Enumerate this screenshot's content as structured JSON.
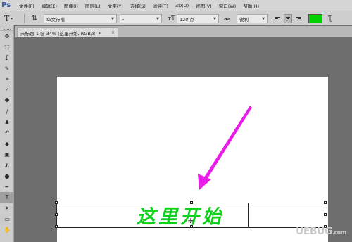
{
  "app": {
    "logo": "Ps"
  },
  "menu": [
    "文件(F)",
    "编辑(E)",
    "图像(I)",
    "图层(L)",
    "文字(Y)",
    "选择(S)",
    "滤镜(T)",
    "3D(D)",
    "视图(V)",
    "窗口(W)",
    "帮助(H)"
  ],
  "options_bar": {
    "tool_icon": "T",
    "font_family": "华文行楷",
    "font_style": "-",
    "font_size": "120 点",
    "anti_alias": "锐利",
    "aa_label": "aa",
    "text_color": "#00d000",
    "align_active": "center"
  },
  "document": {
    "tab_title": "未标题-1 @ 34% (这里开始, RGB/8) *",
    "close_glyph": "×"
  },
  "canvas": {
    "typed_text": "这里开始",
    "arrow_color": "#e81ee8"
  },
  "toolbar": {
    "tools": [
      {
        "name": "move-tool",
        "glyph": "✥"
      },
      {
        "name": "marquee-tool",
        "glyph": "⬚"
      },
      {
        "name": "lasso-tool",
        "glyph": "ʆ"
      },
      {
        "name": "quick-select-tool",
        "glyph": "✎"
      },
      {
        "name": "crop-tool",
        "glyph": "⌗"
      },
      {
        "name": "eyedropper-tool",
        "glyph": "⁄"
      },
      {
        "name": "healing-tool",
        "glyph": "✚"
      },
      {
        "name": "brush-tool",
        "glyph": "∕"
      },
      {
        "name": "stamp-tool",
        "glyph": "♟"
      },
      {
        "name": "history-brush-tool",
        "glyph": "↶"
      },
      {
        "name": "eraser-tool",
        "glyph": "◆"
      },
      {
        "name": "gradient-tool",
        "glyph": "▣"
      },
      {
        "name": "blur-tool",
        "glyph": "◭"
      },
      {
        "name": "dodge-tool",
        "glyph": "●"
      },
      {
        "name": "pen-tool",
        "glyph": "✒"
      },
      {
        "name": "type-tool",
        "glyph": "T"
      },
      {
        "name": "path-select-tool",
        "glyph": "➤"
      },
      {
        "name": "shape-tool",
        "glyph": "▭"
      },
      {
        "name": "hand-tool",
        "glyph": "✋"
      }
    ]
  },
  "watermark": {
    "main": "UEBUG",
    "suffix": ".com"
  }
}
